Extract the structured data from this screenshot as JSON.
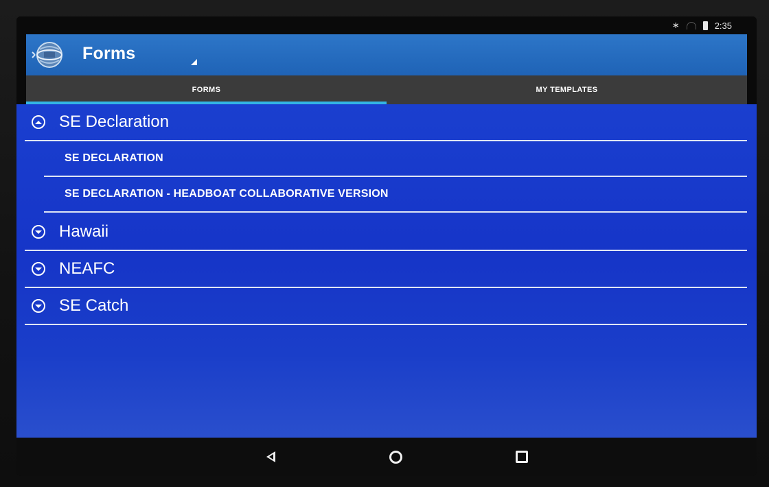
{
  "status_bar": {
    "time": "2:35",
    "icons": [
      "bluetooth-icon",
      "wifi-icon",
      "battery-icon"
    ]
  },
  "app_bar": {
    "title": "Forms",
    "logo_icon": "app-globe-logo-icon"
  },
  "tabs": [
    {
      "label": "FORMS",
      "selected": true
    },
    {
      "label": "MY TEMPLATES",
      "selected": false
    }
  ],
  "groups": [
    {
      "label": "SE Declaration",
      "expanded": true,
      "children": [
        {
          "label": "SE DECLARATION"
        },
        {
          "label": "SE DECLARATION - HEADBOAT COLLABORATIVE VERSION"
        }
      ]
    },
    {
      "label": "Hawaii",
      "expanded": false,
      "children": []
    },
    {
      "label": "NEAFC",
      "expanded": false,
      "children": []
    },
    {
      "label": "SE Catch",
      "expanded": false,
      "children": []
    }
  ],
  "nav_bar": {
    "buttons": [
      "back-icon",
      "home-icon",
      "recent-apps-icon"
    ]
  },
  "colors": {
    "app_bar": "#2d76c8",
    "tab_bar": "#3b3b3b",
    "tab_indicator": "#33b5e5",
    "content_background": "#1a3fcf",
    "divider": "#dfe6f5",
    "text": "#ffffff"
  }
}
